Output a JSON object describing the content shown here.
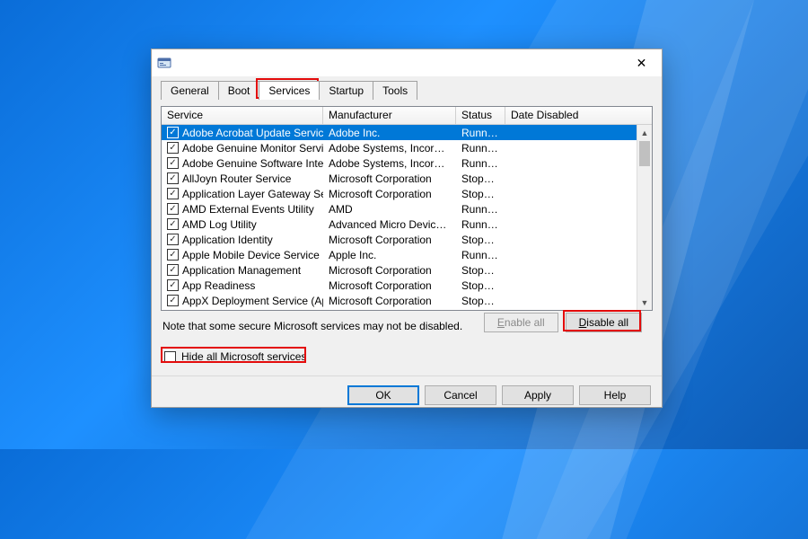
{
  "titlebar": {
    "close": "✕"
  },
  "tabs": {
    "general": "General",
    "boot": "Boot",
    "services": "Services",
    "startup": "Startup",
    "tools": "Tools"
  },
  "columns": {
    "service": "Service",
    "manufacturer": "Manufacturer",
    "status": "Status",
    "date_disabled": "Date Disabled"
  },
  "rows": [
    {
      "service": "Adobe Acrobat Update Service",
      "manufacturer": "Adobe Inc.",
      "status": "Running",
      "date": "",
      "checked": true,
      "selected": true
    },
    {
      "service": "Adobe Genuine Monitor Service",
      "manufacturer": "Adobe Systems, Incorpora...",
      "status": "Running",
      "date": "",
      "checked": true
    },
    {
      "service": "Adobe Genuine Software Integri...",
      "manufacturer": "Adobe Systems, Incorpora...",
      "status": "Running",
      "date": "",
      "checked": true
    },
    {
      "service": "AllJoyn Router Service",
      "manufacturer": "Microsoft Corporation",
      "status": "Stopped",
      "date": "",
      "checked": true
    },
    {
      "service": "Application Layer Gateway Service",
      "manufacturer": "Microsoft Corporation",
      "status": "Stopped",
      "date": "",
      "checked": true
    },
    {
      "service": "AMD External Events Utility",
      "manufacturer": "AMD",
      "status": "Running",
      "date": "",
      "checked": true
    },
    {
      "service": "AMD Log Utility",
      "manufacturer": "Advanced Micro Devices, I...",
      "status": "Running",
      "date": "",
      "checked": true
    },
    {
      "service": "Application Identity",
      "manufacturer": "Microsoft Corporation",
      "status": "Stopped",
      "date": "",
      "checked": true
    },
    {
      "service": "Apple Mobile Device Service",
      "manufacturer": "Apple Inc.",
      "status": "Running",
      "date": "",
      "checked": true
    },
    {
      "service": "Application Management",
      "manufacturer": "Microsoft Corporation",
      "status": "Stopped",
      "date": "",
      "checked": true
    },
    {
      "service": "App Readiness",
      "manufacturer": "Microsoft Corporation",
      "status": "Stopped",
      "date": "",
      "checked": true
    },
    {
      "service": "AppX Deployment Service (AppX...",
      "manufacturer": "Microsoft Corporation",
      "status": "Stopped",
      "date": "",
      "checked": true
    }
  ],
  "note": "Note that some secure Microsoft services may not be disabled.",
  "buttons": {
    "enable_all": "Enable all",
    "disable_all": "Disable all",
    "hide_ms": "Hide all Microsoft services",
    "ok": "OK",
    "cancel": "Cancel",
    "apply": "Apply",
    "help": "Help"
  }
}
